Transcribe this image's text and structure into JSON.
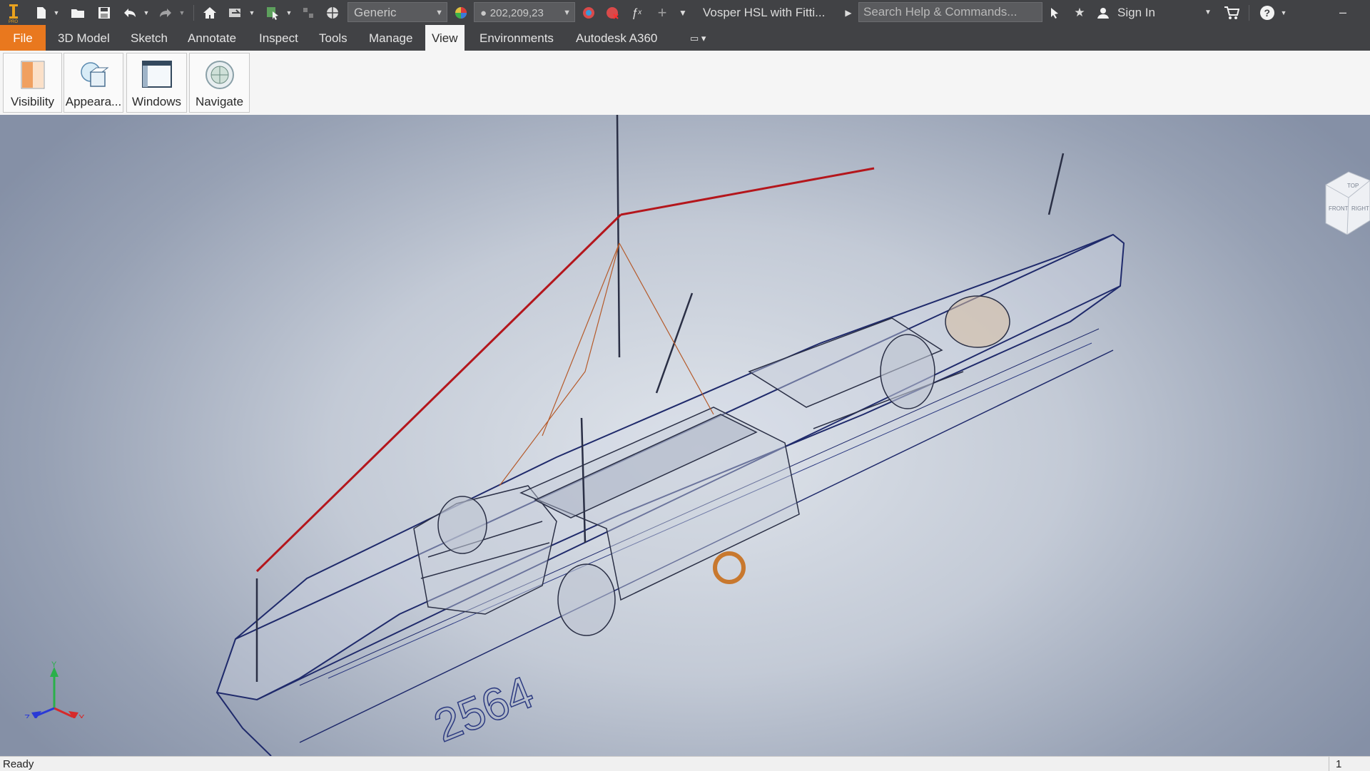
{
  "app": {
    "document_title": "Vosper HSL with Fitti...",
    "material_combo": "Generic",
    "appearance_combo": "202,209,23",
    "search_placeholder": "Search Help & Commands...",
    "sign_in": "Sign In",
    "app_logo_letters": "I PRO"
  },
  "menu": {
    "file": "File",
    "tabs": [
      "3D Model",
      "Sketch",
      "Annotate",
      "Inspect",
      "Tools",
      "Manage",
      "View",
      "Environments",
      "Autodesk A360"
    ],
    "active_tab": "View"
  },
  "ribbon": {
    "buttons": [
      {
        "label": "Visibility",
        "icon": "visibility-icon"
      },
      {
        "label": "Appeara...",
        "icon": "appearance-icon"
      },
      {
        "label": "Windows",
        "icon": "windows-icon"
      },
      {
        "label": "Navigate",
        "icon": "navigate-icon"
      }
    ]
  },
  "viewport": {
    "hull_number": "2564",
    "axes": {
      "x": "X",
      "y": "Y",
      "z": "Z"
    },
    "viewcube_faces": {
      "top": "TOP",
      "front": "FRONT",
      "right": "RIGHT"
    }
  },
  "status": {
    "left": "Ready",
    "right": "1"
  },
  "colors": {
    "accent": "#e9781e",
    "titlebar": "#414245",
    "model_lines": "#1f2a6b",
    "rigging": "#b4161c"
  }
}
